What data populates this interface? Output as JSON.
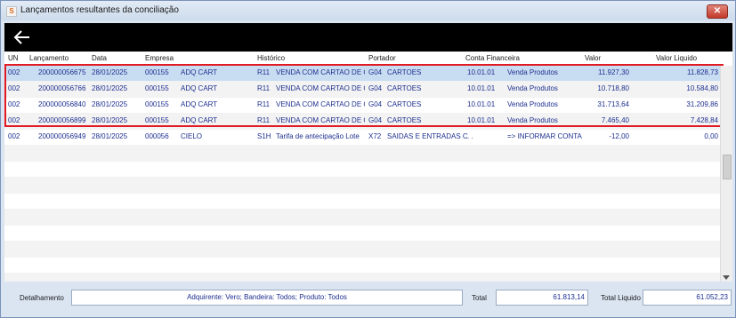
{
  "window": {
    "title": "Lançamentos resultantes da conciliação",
    "close_label": "✕",
    "app_icon": "S"
  },
  "colors": {
    "highlight": "#e01b24",
    "selected_row": "#c9ddf2",
    "text": "#1d2f8f",
    "toolbar": "#000000"
  },
  "toolbar": {
    "back_icon": "arrow-left-icon"
  },
  "columns": [
    "UN",
    "Lançamento",
    "Data",
    "Empresa",
    "Histórico",
    "Portador",
    "Conta Financeira",
    "Valor",
    "Valor Liquido"
  ],
  "rows": [
    {
      "un": "002",
      "lanc": "200000056675",
      "data": "28/01/2025",
      "emp_cod": "000155",
      "emp_nome": "ADQ CART",
      "hist_cod": "R11",
      "hist": "VENDA COM CARTAO DE C",
      "port_cod": "G04",
      "port": "CARTOES",
      "conta_cod": "10.01.01",
      "conta": "Venda Produtos",
      "valor": "11.927,30",
      "liquido": "11.828,73"
    },
    {
      "un": "002",
      "lanc": "200000056766",
      "data": "28/01/2025",
      "emp_cod": "000155",
      "emp_nome": "ADQ CART",
      "hist_cod": "R11",
      "hist": "VENDA COM CARTAO DE C",
      "port_cod": "G04",
      "port": "CARTOES",
      "conta_cod": "10.01.01",
      "conta": "Venda Produtos",
      "valor": "10.718,80",
      "liquido": "10.584,80"
    },
    {
      "un": "002",
      "lanc": "200000056840",
      "data": "28/01/2025",
      "emp_cod": "000155",
      "emp_nome": "ADQ CART",
      "hist_cod": "R11",
      "hist": "VENDA COM CARTAO DE C",
      "port_cod": "G04",
      "port": "CARTOES",
      "conta_cod": "10.01.01",
      "conta": "Venda Produtos",
      "valor": "31.713,64",
      "liquido": "31.209,86"
    },
    {
      "un": "002",
      "lanc": "200000056899",
      "data": "28/01/2025",
      "emp_cod": "000155",
      "emp_nome": "ADQ CART",
      "hist_cod": "R11",
      "hist": "VENDA COM CARTAO DE C",
      "port_cod": "G04",
      "port": "CARTOES",
      "conta_cod": "10.01.01",
      "conta": "Venda Produtos",
      "valor": "7.465,40",
      "liquido": "7.428,84"
    },
    {
      "un": "002",
      "lanc": "200000056949",
      "data": "28/01/2025",
      "emp_cod": "000056",
      "emp_nome": "CIELO",
      "hist_cod": "S1H",
      "hist": "Tarifa de antecipação Lote",
      "port_cod": "X72",
      "port": "SAIDAS E ENTRADAS C",
      "conta_cod": ". .",
      "conta": "=> INFORMAR CONTA",
      "valor": "-12,00",
      "liquido": "0,00"
    }
  ],
  "footer": {
    "detalhamento_label": "Detalhamento",
    "detalhamento_value": "Adquirente: Vero; Bandeira: Todos; Produto: Todos",
    "total_label": "Total",
    "total_value": "61.813,14",
    "total_liquido_label": "Total Liquido",
    "total_liquido_value": "61.052,23"
  }
}
